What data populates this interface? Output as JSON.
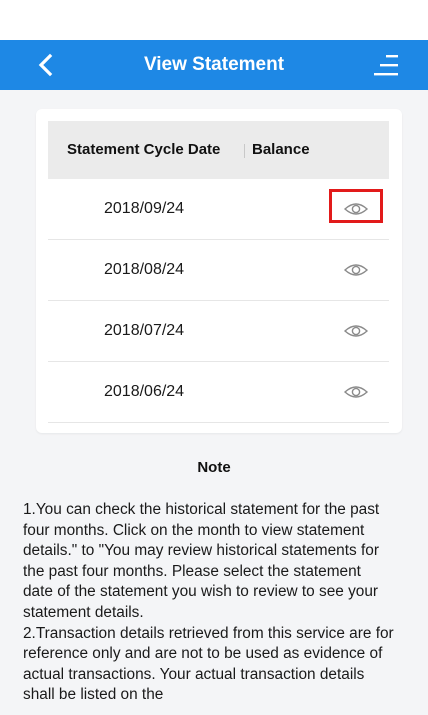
{
  "header": {
    "title": "View Statement"
  },
  "table": {
    "col_date": "Statement Cycle Date",
    "col_balance": "Balance",
    "rows": [
      {
        "date": "2018/09/24",
        "highlighted": true
      },
      {
        "date": "2018/08/24",
        "highlighted": false
      },
      {
        "date": "2018/07/24",
        "highlighted": false
      },
      {
        "date": "2018/06/24",
        "highlighted": false
      }
    ]
  },
  "note": {
    "title": "Note",
    "body": "1.You can check the historical statement for the past four months. Click on the month to view statement details.\" to \"You may review historical statements for the past four months. Please select the statement date of the statement you wish to review to see your statement details.\n2.Transaction details retrieved from this service are for reference only and are not to be used as evidence of actual transactions. Your actual transaction details shall be listed on the"
  },
  "colors": {
    "appbar": "#1e88e5",
    "highlight": "#e21a1a",
    "background": "#f4f5f7"
  },
  "icons": {
    "back": "chevron-left-icon",
    "menu": "menu-lines-icon",
    "view": "eye-icon"
  }
}
